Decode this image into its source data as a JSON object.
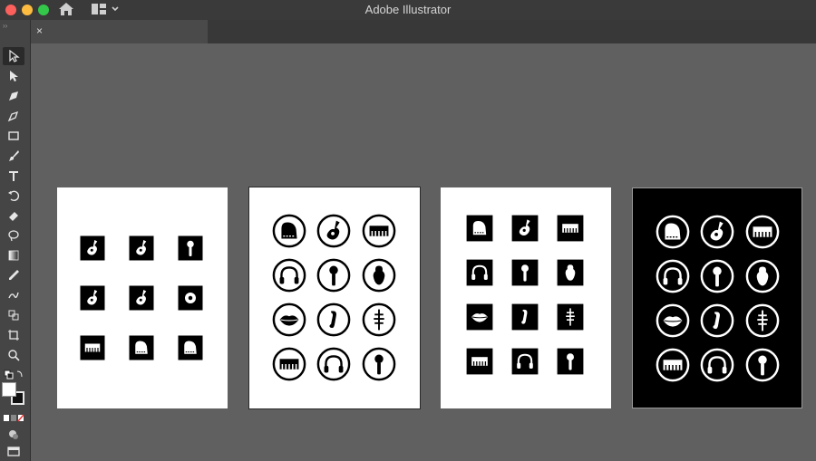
{
  "window": {
    "title": "Adobe Illustrator"
  },
  "titlebar": {
    "icons": [
      "close-traffic",
      "minimize-traffic",
      "zoom-traffic",
      "home-icon",
      "workspace-switcher-icon",
      "chevron-down-icon"
    ]
  },
  "document_tab": {
    "close_label": "×"
  },
  "tools": [
    "selection-tool-icon",
    "direct-selection-tool-icon",
    "pen-tool-icon",
    "curvature-tool-icon",
    "rectangle-tool-icon",
    "paintbrush-tool-icon",
    "type-tool-icon",
    "rotate-tool-icon",
    "eraser-tool-icon",
    "lasso-tool-icon",
    "gradient-tool-icon",
    "eyedropper-tool-icon",
    "shape-builder-tool-icon",
    "blend-tool-icon",
    "artboard-tool-icon",
    "zoom-tool-icon",
    "fill-stroke-icon",
    "drawing-mode-icon",
    "screen-mode-icon"
  ],
  "artboards": [
    {
      "name": "artboard-1",
      "style": "square icons on white",
      "icons": [
        "guitar",
        "guitar",
        "microphone",
        "guitar",
        "guitar",
        "drum",
        "keyboard",
        "grand-piano",
        "grand-piano"
      ]
    },
    {
      "name": "artboard-2",
      "style": "black circular icons on white",
      "icons": [
        "grand-piano",
        "guitar",
        "keyboard",
        "headphones",
        "microphone",
        "violin",
        "lips",
        "saxophone",
        "cello",
        "keyboard",
        "headphones",
        "microphone"
      ]
    },
    {
      "name": "artboard-3",
      "style": "black square icons on white",
      "icons": [
        "grand-piano",
        "guitar",
        "keyboard",
        "headphones",
        "microphone",
        "violin",
        "lips",
        "saxophone",
        "cello",
        "keyboard",
        "headphones",
        "microphone"
      ]
    },
    {
      "name": "artboard-4",
      "style": "white circular icons on black",
      "icons": [
        "grand-piano",
        "guitar",
        "keyboard",
        "headphones",
        "microphone",
        "violin",
        "lips",
        "saxophone",
        "cello",
        "keyboard",
        "headphones",
        "microphone"
      ]
    }
  ],
  "colors": {
    "titlebar": "#3a3a3a",
    "toolbar": "#454545",
    "canvas": "#606060",
    "artboard_white": "#ffffff",
    "artboard_black": "#000000"
  }
}
